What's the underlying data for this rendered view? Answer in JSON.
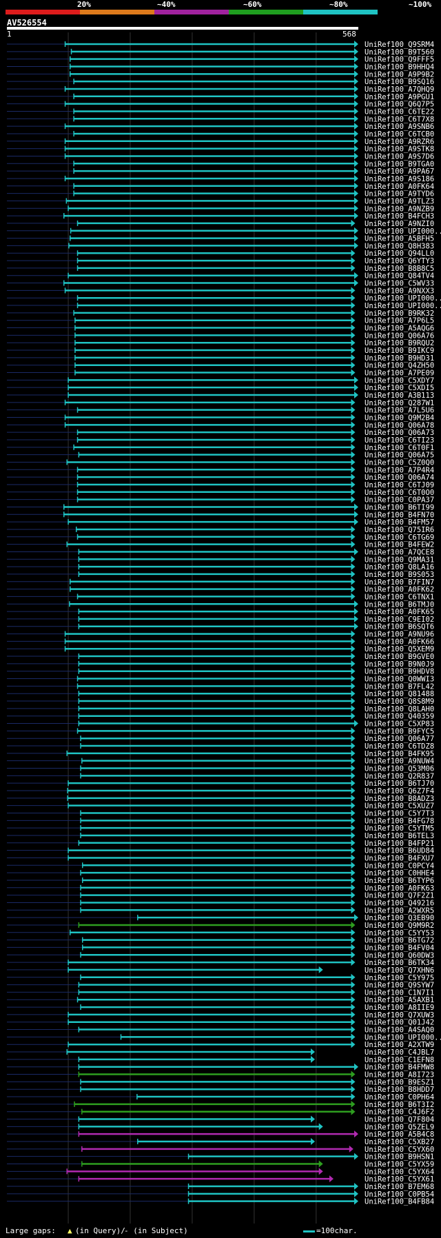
{
  "query": {
    "id": "AV526554",
    "start": "1",
    "end": "568"
  },
  "legend": {
    "labels": [
      "20%",
      "~40%",
      "~60%",
      "~80%",
      "~100%"
    ],
    "colors": [
      "#dd1c1c",
      "#dd7a1c",
      "#a0229e",
      "#1f9e1f",
      "#1fc3c3"
    ]
  },
  "footer": {
    "gaps_label": "Large gaps:",
    "query_gap": "(in Query)/",
    "subject_gap": "- (in Subject)",
    "scale_label": "=100char."
  },
  "chart_data": {
    "type": "alignment",
    "query_length": 568,
    "hits": [
      {
        "name": "UniRef100_Q9SRM4",
        "start": 95,
        "end": 568,
        "color": "cyan"
      },
      {
        "name": "UniRef100_B9T560",
        "start": 105,
        "end": 568,
        "color": "cyan"
      },
      {
        "name": "UniRef100_Q9FFF5",
        "start": 103,
        "end": 568,
        "color": "cyan"
      },
      {
        "name": "UniRef100_B9HHQ4",
        "start": 103,
        "end": 568,
        "color": "cyan"
      },
      {
        "name": "UniRef100_A9P9B2",
        "start": 103,
        "end": 568,
        "color": "cyan"
      },
      {
        "name": "UniRef100_B9SQ16",
        "start": 109,
        "end": 568,
        "color": "cyan"
      },
      {
        "name": "UniRef100_A7QHQ9",
        "start": 95,
        "end": 568,
        "color": "cyan"
      },
      {
        "name": "UniRef100_A9PGU1",
        "start": 109,
        "end": 568,
        "color": "cyan"
      },
      {
        "name": "UniRef100_Q6Q7P5",
        "start": 95,
        "end": 568,
        "color": "cyan"
      },
      {
        "name": "UniRef100_C6TE22",
        "start": 109,
        "end": 568,
        "color": "cyan"
      },
      {
        "name": "UniRef100_C6T7X8",
        "start": 109,
        "end": 568,
        "color": "cyan"
      },
      {
        "name": "UniRef100_A9SNB6",
        "start": 95,
        "end": 568,
        "color": "cyan"
      },
      {
        "name": "UniRef100_C6TCB0",
        "start": 109,
        "end": 568,
        "color": "cyan"
      },
      {
        "name": "UniRef100_A9RZR6",
        "start": 95,
        "end": 568,
        "color": "cyan"
      },
      {
        "name": "UniRef100_A9STK8",
        "start": 95,
        "end": 568,
        "color": "cyan"
      },
      {
        "name": "UniRef100_A9S7D6",
        "start": 95,
        "end": 568,
        "color": "cyan"
      },
      {
        "name": "UniRef100_B9TGA0",
        "start": 109,
        "end": 568,
        "color": "cyan"
      },
      {
        "name": "UniRef100_A9PA67",
        "start": 109,
        "end": 568,
        "color": "cyan"
      },
      {
        "name": "UniRef100_A9S186",
        "start": 95,
        "end": 568,
        "color": "cyan"
      },
      {
        "name": "UniRef100_A0FK64",
        "start": 109,
        "end": 568,
        "color": "cyan"
      },
      {
        "name": "UniRef100_A9TYD6",
        "start": 109,
        "end": 568,
        "color": "cyan"
      },
      {
        "name": "UniRef100_A9TLZ3",
        "start": 97,
        "end": 568,
        "color": "cyan"
      },
      {
        "name": "UniRef100_A9NZB9",
        "start": 100,
        "end": 568,
        "color": "cyan"
      },
      {
        "name": "UniRef100_B4FCH3",
        "start": 93,
        "end": 568,
        "color": "cyan"
      },
      {
        "name": "UniRef100_A9NZI0",
        "start": 115,
        "end": 563,
        "color": "cyan"
      },
      {
        "name": "UniRef100_UPI000..",
        "start": 104,
        "end": 568,
        "color": "cyan"
      },
      {
        "name": "UniRef100_A5BFH5",
        "start": 103,
        "end": 568,
        "color": "cyan"
      },
      {
        "name": "UniRef100_Q8H383",
        "start": 101,
        "end": 568,
        "color": "cyan"
      },
      {
        "name": "UniRef100_Q94LL0",
        "start": 115,
        "end": 563,
        "color": "cyan"
      },
      {
        "name": "UniRef100_Q6YTY3",
        "start": 115,
        "end": 563,
        "color": "cyan"
      },
      {
        "name": "UniRef100_B8B8C5",
        "start": 115,
        "end": 563,
        "color": "cyan"
      },
      {
        "name": "UniRef100_Q84TV4",
        "start": 100,
        "end": 568,
        "color": "cyan"
      },
      {
        "name": "UniRef100_C5WV33",
        "start": 93,
        "end": 568,
        "color": "cyan"
      },
      {
        "name": "UniRef100_A9NXX3",
        "start": 95,
        "end": 563,
        "color": "cyan"
      },
      {
        "name": "UniRef100_UPI000..",
        "start": 115,
        "end": 563,
        "color": "cyan"
      },
      {
        "name": "UniRef100_UPI000..",
        "start": 115,
        "end": 563,
        "color": "cyan"
      },
      {
        "name": "UniRef100_B9RK32",
        "start": 109,
        "end": 563,
        "color": "cyan"
      },
      {
        "name": "UniRef100_A7P6L5",
        "start": 111,
        "end": 563,
        "color": "cyan"
      },
      {
        "name": "UniRef100_A5AQG6",
        "start": 111,
        "end": 563,
        "color": "cyan"
      },
      {
        "name": "UniRef100_Q06A76",
        "start": 111,
        "end": 563,
        "color": "cyan"
      },
      {
        "name": "UniRef100_B9RQU2",
        "start": 111,
        "end": 563,
        "color": "cyan"
      },
      {
        "name": "UniRef100_B9IKC9",
        "start": 111,
        "end": 563,
        "color": "cyan"
      },
      {
        "name": "UniRef100_B9HD31",
        "start": 111,
        "end": 563,
        "color": "cyan"
      },
      {
        "name": "UniRef100_Q4ZH50",
        "start": 111,
        "end": 563,
        "color": "cyan"
      },
      {
        "name": "UniRef100_A7PE09",
        "start": 111,
        "end": 563,
        "color": "cyan"
      },
      {
        "name": "UniRef100_C5XDY7",
        "start": 100,
        "end": 568,
        "color": "cyan"
      },
      {
        "name": "UniRef100_C5XDI5",
        "start": 100,
        "end": 568,
        "color": "cyan"
      },
      {
        "name": "UniRef100_A3B113",
        "start": 100,
        "end": 568,
        "color": "cyan"
      },
      {
        "name": "UniRef100_Q287W1",
        "start": 95,
        "end": 563,
        "color": "cyan"
      },
      {
        "name": "UniRef100_A7L5U6",
        "start": 115,
        "end": 563,
        "color": "cyan"
      },
      {
        "name": "UniRef100_Q9M2B4",
        "start": 95,
        "end": 563,
        "color": "cyan"
      },
      {
        "name": "UniRef100_Q06A78",
        "start": 95,
        "end": 563,
        "color": "cyan"
      },
      {
        "name": "UniRef100_Q06A73",
        "start": 115,
        "end": 563,
        "color": "cyan"
      },
      {
        "name": "UniRef100_C6TI23",
        "start": 115,
        "end": 563,
        "color": "cyan"
      },
      {
        "name": "UniRef100_C6T0F1",
        "start": 109,
        "end": 563,
        "color": "cyan"
      },
      {
        "name": "UniRef100_Q06A75",
        "start": 117,
        "end": 563,
        "color": "cyan"
      },
      {
        "name": "UniRef100_C5Z0Q0",
        "start": 98,
        "end": 563,
        "color": "cyan"
      },
      {
        "name": "UniRef100_A7P4R4",
        "start": 115,
        "end": 563,
        "color": "cyan"
      },
      {
        "name": "UniRef100_Q06A74",
        "start": 115,
        "end": 563,
        "color": "cyan"
      },
      {
        "name": "UniRef100_C6TJ09",
        "start": 115,
        "end": 563,
        "color": "cyan"
      },
      {
        "name": "UniRef100_C6T0O0",
        "start": 115,
        "end": 563,
        "color": "cyan"
      },
      {
        "name": "UniRef100_C0PA37",
        "start": 115,
        "end": 563,
        "color": "cyan"
      },
      {
        "name": "UniRef100_B6TI99",
        "start": 93,
        "end": 568,
        "color": "cyan"
      },
      {
        "name": "UniRef100_B4FN70",
        "start": 93,
        "end": 568,
        "color": "cyan"
      },
      {
        "name": "UniRef100_B4FM57",
        "start": 100,
        "end": 568,
        "color": "cyan"
      },
      {
        "name": "UniRef100_Q75IR6",
        "start": 113,
        "end": 563,
        "color": "cyan"
      },
      {
        "name": "UniRef100_C6TG69",
        "start": 115,
        "end": 563,
        "color": "cyan"
      },
      {
        "name": "UniRef100_B4FEW2",
        "start": 98,
        "end": 563,
        "color": "cyan"
      },
      {
        "name": "UniRef100_A7QCE8",
        "start": 117,
        "end": 568,
        "color": "cyan"
      },
      {
        "name": "UniRef100_Q9MA31",
        "start": 117,
        "end": 563,
        "color": "cyan"
      },
      {
        "name": "UniRef100_Q8LA16",
        "start": 117,
        "end": 563,
        "color": "cyan"
      },
      {
        "name": "UniRef100_B9S053",
        "start": 117,
        "end": 563,
        "color": "cyan"
      },
      {
        "name": "UniRef100_B7FIN7",
        "start": 103,
        "end": 563,
        "color": "cyan"
      },
      {
        "name": "UniRef100_A0FK62",
        "start": 103,
        "end": 563,
        "color": "cyan"
      },
      {
        "name": "UniRef100_C6TNX1",
        "start": 115,
        "end": 563,
        "color": "cyan"
      },
      {
        "name": "UniRef100_B6TMJ0",
        "start": 102,
        "end": 568,
        "color": "cyan"
      },
      {
        "name": "UniRef100_A0FK65",
        "start": 117,
        "end": 568,
        "color": "cyan"
      },
      {
        "name": "UniRef100_C9EI02",
        "start": 117,
        "end": 568,
        "color": "cyan"
      },
      {
        "name": "UniRef100_B6SQT6",
        "start": 117,
        "end": 568,
        "color": "cyan"
      },
      {
        "name": "UniRef100_A9NU96",
        "start": 95,
        "end": 563,
        "color": "cyan"
      },
      {
        "name": "UniRef100_A0FK66",
        "start": 95,
        "end": 563,
        "color": "cyan"
      },
      {
        "name": "UniRef100_Q5XEM9",
        "start": 95,
        "end": 563,
        "color": "cyan"
      },
      {
        "name": "UniRef100_B9GVE0",
        "start": 117,
        "end": 563,
        "color": "cyan"
      },
      {
        "name": "UniRef100_B9N0J9",
        "start": 117,
        "end": 563,
        "color": "cyan"
      },
      {
        "name": "UniRef100_B9HDV8",
        "start": 117,
        "end": 563,
        "color": "cyan"
      },
      {
        "name": "UniRef100_Q0WWI3",
        "start": 115,
        "end": 563,
        "color": "cyan"
      },
      {
        "name": "UniRef100_B7FL42",
        "start": 115,
        "end": 563,
        "color": "cyan"
      },
      {
        "name": "UniRef100_Q81488",
        "start": 117,
        "end": 563,
        "color": "cyan"
      },
      {
        "name": "UniRef100_Q8S8M9",
        "start": 117,
        "end": 563,
        "color": "cyan"
      },
      {
        "name": "UniRef100_Q8LAH0",
        "start": 117,
        "end": 563,
        "color": "cyan"
      },
      {
        "name": "UniRef100_Q40359",
        "start": 117,
        "end": 563,
        "color": "cyan"
      },
      {
        "name": "UniRef100_C5XP83",
        "start": 117,
        "end": 568,
        "color": "cyan"
      },
      {
        "name": "UniRef100_B9FYC5",
        "start": 115,
        "end": 563,
        "color": "cyan"
      },
      {
        "name": "UniRef100_Q06A77",
        "start": 120,
        "end": 563,
        "color": "cyan"
      },
      {
        "name": "UniRef100_C6TDZ8",
        "start": 120,
        "end": 563,
        "color": "cyan"
      },
      {
        "name": "UniRef100_B4FK95",
        "start": 98,
        "end": 563,
        "color": "cyan"
      },
      {
        "name": "UniRef100_A9NUW4",
        "start": 122,
        "end": 563,
        "color": "cyan"
      },
      {
        "name": "UniRef100_Q53M06",
        "start": 120,
        "end": 563,
        "color": "cyan"
      },
      {
        "name": "UniRef100_Q2R837",
        "start": 120,
        "end": 563,
        "color": "cyan"
      },
      {
        "name": "UniRef100_B6TJ70",
        "start": 100,
        "end": 563,
        "color": "cyan"
      },
      {
        "name": "UniRef100_Q6Z7F4",
        "start": 99,
        "end": 563,
        "color": "cyan"
      },
      {
        "name": "UniRef100_B8ADZ3",
        "start": 99,
        "end": 563,
        "color": "cyan"
      },
      {
        "name": "UniRef100_C5XUZ7",
        "start": 100,
        "end": 563,
        "color": "cyan"
      },
      {
        "name": "UniRef100_C5Y7T3",
        "start": 120,
        "end": 563,
        "color": "cyan"
      },
      {
        "name": "UniRef100_B4FG78",
        "start": 120,
        "end": 563,
        "color": "cyan"
      },
      {
        "name": "UniRef100_C5YTM5",
        "start": 120,
        "end": 563,
        "color": "cyan"
      },
      {
        "name": "UniRef100_B6TEL3",
        "start": 120,
        "end": 563,
        "color": "cyan"
      },
      {
        "name": "UniRef100_B4FP21",
        "start": 117,
        "end": 563,
        "color": "cyan"
      },
      {
        "name": "UniRef100_B6UD84",
        "start": 100,
        "end": 563,
        "color": "cyan"
      },
      {
        "name": "UniRef100_B4FXU7",
        "start": 100,
        "end": 563,
        "color": "cyan"
      },
      {
        "name": "UniRef100_C0PCY4",
        "start": 123,
        "end": 563,
        "color": "cyan"
      },
      {
        "name": "UniRef100_C0HHE4",
        "start": 120,
        "end": 563,
        "color": "cyan"
      },
      {
        "name": "UniRef100_B6TYP6",
        "start": 123,
        "end": 563,
        "color": "cyan"
      },
      {
        "name": "UniRef100_A0FK63",
        "start": 120,
        "end": 563,
        "color": "cyan"
      },
      {
        "name": "UniRef100_Q7F2Z1",
        "start": 120,
        "end": 563,
        "color": "cyan"
      },
      {
        "name": "UniRef100_Q49216",
        "start": 120,
        "end": 563,
        "color": "cyan"
      },
      {
        "name": "UniRef100_A2WXR5",
        "start": 120,
        "end": 563,
        "color": "cyan"
      },
      {
        "name": "UniRef100_Q3EB90",
        "start": 212,
        "end": 568,
        "color": "cyan"
      },
      {
        "name": "UniRef100_Q9M9R2",
        "start": 117,
        "end": 563,
        "color": "green"
      },
      {
        "name": "UniRef100_C5YY53",
        "start": 103,
        "end": 563,
        "color": "cyan"
      },
      {
        "name": "UniRef100_B6TG72",
        "start": 123,
        "end": 563,
        "color": "cyan"
      },
      {
        "name": "UniRef100_B4FV04",
        "start": 123,
        "end": 563,
        "color": "cyan"
      },
      {
        "name": "UniRef100_Q60DW3",
        "start": 120,
        "end": 563,
        "color": "cyan"
      },
      {
        "name": "UniRef100_B6TK34",
        "start": 100,
        "end": 563,
        "color": "cyan"
      },
      {
        "name": "UniRef100_Q7XHN6",
        "start": 100,
        "end": 511,
        "color": "cyan"
      },
      {
        "name": "UniRef100_C5Y975",
        "start": 120,
        "end": 563,
        "color": "cyan"
      },
      {
        "name": "UniRef100_Q9SYW7",
        "start": 117,
        "end": 563,
        "color": "cyan"
      },
      {
        "name": "UniRef100_C1N7I1",
        "start": 117,
        "end": 563,
        "color": "cyan"
      },
      {
        "name": "UniRef100_A5AXB1",
        "start": 115,
        "end": 563,
        "color": "cyan"
      },
      {
        "name": "UniRef100_A8IIE9",
        "start": 120,
        "end": 563,
        "color": "cyan"
      },
      {
        "name": "UniRef100_Q7XUW3",
        "start": 100,
        "end": 563,
        "color": "cyan"
      },
      {
        "name": "UniRef100_Q01J42",
        "start": 100,
        "end": 563,
        "color": "cyan"
      },
      {
        "name": "UniRef100_A4SAQ0",
        "start": 117,
        "end": 563,
        "color": "cyan"
      },
      {
        "name": "UniRef100_UPI000..",
        "start": 185,
        "end": 563,
        "color": "cyan"
      },
      {
        "name": "UniRef100_A2XTW9",
        "start": 100,
        "end": 563,
        "color": "cyan"
      },
      {
        "name": "UniRef100_C4JBL7",
        "start": 98,
        "end": 498,
        "color": "cyan"
      },
      {
        "name": "UniRef100_C1EFN8",
        "start": 117,
        "end": 498,
        "color": "cyan"
      },
      {
        "name": "UniRef100_B4FMW8",
        "start": 117,
        "end": 568,
        "color": "cyan"
      },
      {
        "name": "UniRef100_A8I723",
        "start": 117,
        "end": 563,
        "color": "green"
      },
      {
        "name": "UniRef100_B9ESZ1",
        "start": 120,
        "end": 563,
        "color": "cyan"
      },
      {
        "name": "UniRef100_B8HDD7",
        "start": 120,
        "end": 563,
        "color": "cyan"
      },
      {
        "name": "UniRef100_C0PH64",
        "start": 211,
        "end": 563,
        "color": "cyan"
      },
      {
        "name": "UniRef100_B6T3I2",
        "start": 110,
        "end": 563,
        "color": "green"
      },
      {
        "name": "UniRef100_C4J6F2",
        "start": 122,
        "end": 563,
        "color": "green"
      },
      {
        "name": "UniRef100_Q7F804",
        "start": 117,
        "end": 498,
        "color": "cyan"
      },
      {
        "name": "UniRef100_Q5ZEL9",
        "start": 117,
        "end": 511,
        "color": "cyan"
      },
      {
        "name": "UniRef100_A5B4C8",
        "start": 117,
        "end": 568,
        "color": "magenta"
      },
      {
        "name": "UniRef100_C5XB27",
        "start": 212,
        "end": 498,
        "color": "cyan"
      },
      {
        "name": "UniRef100_C5YX60",
        "start": 122,
        "end": 560,
        "color": "magenta"
      },
      {
        "name": "UniRef100_B9HSN1",
        "start": 294,
        "end": 568,
        "color": "cyan"
      },
      {
        "name": "UniRef100_C5YX59",
        "start": 122,
        "end": 511,
        "color": "green"
      },
      {
        "name": "UniRef100_C5YX64",
        "start": 98,
        "end": 511,
        "color": "magenta"
      },
      {
        "name": "UniRef100_C5YX61",
        "start": 117,
        "end": 528,
        "color": "magenta"
      },
      {
        "name": "UniRef100_B7EM68",
        "start": 294,
        "end": 568,
        "color": "cyan"
      },
      {
        "name": "UniRef100_C0PB54",
        "start": 294,
        "end": 568,
        "color": "cyan"
      },
      {
        "name": "UniRef100_B4FB84",
        "start": 294,
        "end": 568,
        "color": "cyan"
      }
    ]
  }
}
